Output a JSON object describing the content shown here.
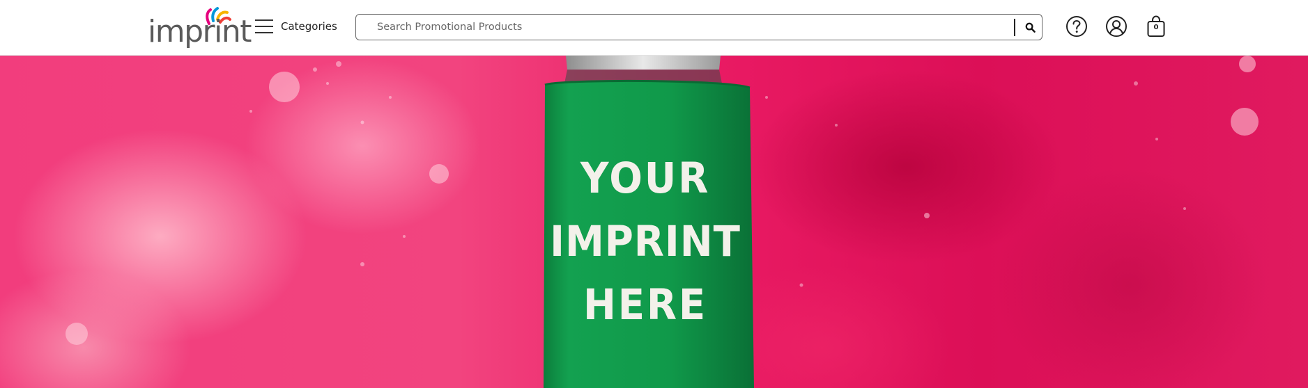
{
  "header": {
    "logo": {
      "text": "imprint",
      "mark_colors": [
        "#e6007e",
        "#0098d8",
        "#f7b500",
        "#ef3e36"
      ]
    },
    "categories": {
      "label": "Categories",
      "icon": "hamburger-menu-icon"
    },
    "search": {
      "value": "",
      "placeholder": "Search Promotional Products",
      "button_icon": "search-icon"
    },
    "actions": {
      "help_icon": "question-circle-icon",
      "account_icon": "user-circle-icon",
      "cart_icon": "shopping-bag-icon",
      "cart_count": "0"
    }
  },
  "hero": {
    "product_lines": [
      "YOUR",
      "IMPRINT",
      "HERE"
    ],
    "colors": {
      "background": "#ee2d72",
      "koozie": "#109a4a",
      "text": "#f3f1ea"
    }
  }
}
